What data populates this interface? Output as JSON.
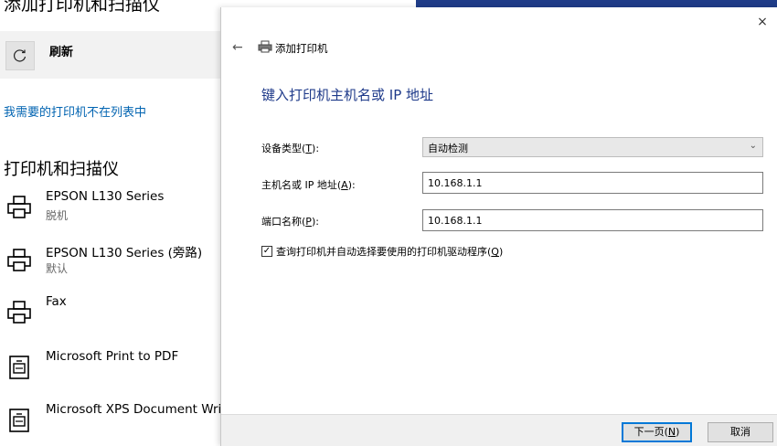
{
  "background": {
    "title": "添加打印机和扫描仪",
    "refresh_label": "刷新",
    "missing_link": "我需要的打印机不在列表中",
    "section_heading": "打印机和扫描仪",
    "printers": [
      {
        "name": "EPSON L130 Series",
        "status": "脱机"
      },
      {
        "name": "EPSON L130 Series (旁路)",
        "status": "默认"
      },
      {
        "name": "Fax",
        "status": ""
      },
      {
        "name": "Microsoft Print to PDF",
        "status": ""
      },
      {
        "name": "Microsoft XPS Document Writer",
        "status": ""
      }
    ]
  },
  "dialog": {
    "close_glyph": "×",
    "back_glyph": "←",
    "title": "添加打印机",
    "heading": "键入打印机主机名或 IP 地址",
    "device_type": {
      "label": "设备类型",
      "key": "T",
      "value": "自动检测"
    },
    "hostname": {
      "label": "主机名或 IP 地址",
      "key": "A",
      "value": "10.168.1.1"
    },
    "port_name": {
      "label": "端口名称",
      "key": "P",
      "value": "10.168.1.1"
    },
    "query_checkbox": {
      "label": "查询打印机并自动选择要使用的打印机驱动程序",
      "key": "Q",
      "checked": true,
      "glyph": "✓"
    },
    "next_button": {
      "label": "下一页",
      "key": "N"
    },
    "cancel_button": "取消"
  },
  "colors": {
    "accent": "#0078d7",
    "heading": "#1e3a8a",
    "link": "#0063b1",
    "strip": "#1f3c88"
  }
}
